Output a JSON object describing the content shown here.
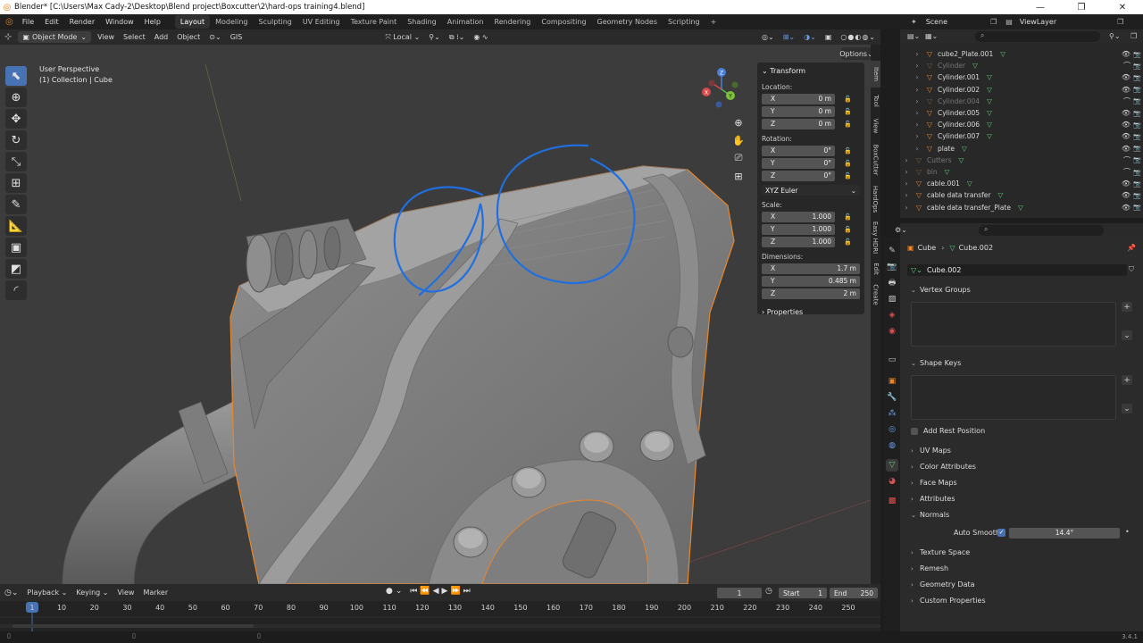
{
  "window": {
    "title": "Blender* [C:\\Users\\Max Cady-2\\Desktop\\Blend project\\Boxcutter\\2\\hard-ops training4.blend]",
    "controls": [
      "—",
      "❐",
      "✕"
    ]
  },
  "menu": [
    "File",
    "Edit",
    "Render",
    "Window",
    "Help"
  ],
  "workspaces": {
    "tabs": [
      "Layout",
      "Modeling",
      "Sculpting",
      "UV Editing",
      "Texture Paint",
      "Shading",
      "Animation",
      "Rendering",
      "Compositing",
      "Geometry Nodes",
      "Scripting"
    ],
    "active": "Layout",
    "add": "+"
  },
  "top_right": {
    "scene": "Scene",
    "view_layer": "ViewLayer"
  },
  "viewport_header": {
    "mode": "Object Mode",
    "menus": [
      "View",
      "Select",
      "Add",
      "Object"
    ],
    "gis": "GIS",
    "transform_orientation": "Local"
  },
  "viewport": {
    "view_name": "User Perspective",
    "collection_info": "(1) Collection | Cube",
    "options": "Options",
    "gizmo": {
      "x": "X",
      "y": "Y",
      "z": "Z"
    }
  },
  "n_panel": {
    "title": "Transform",
    "location": {
      "label": "Location:",
      "x": "0 m",
      "y": "0 m",
      "z": "0 m"
    },
    "rotation": {
      "label": "Rotation:",
      "x": "0°",
      "y": "0°",
      "z": "0°"
    },
    "rotation_mode": "XYZ Euler",
    "scale": {
      "label": "Scale:",
      "x": "1.000",
      "y": "1.000",
      "z": "1.000"
    },
    "dimensions": {
      "label": "Dimensions:",
      "x": "1.7 m",
      "y": "0.485 m",
      "z": "2 m"
    },
    "properties": "Properties",
    "axis": {
      "x": "X",
      "y": "Y",
      "z": "Z"
    }
  },
  "side_tabs": [
    "Item",
    "Tool",
    "View",
    "BoxCutter",
    "HardOps",
    "Easy HDRI",
    "Edit",
    "Create"
  ],
  "outliner": {
    "rows": [
      {
        "name": "cube2_Plate.001",
        "dim": false,
        "indent": 1
      },
      {
        "name": "Cylinder",
        "dim": true,
        "indent": 1
      },
      {
        "name": "Cylinder.001",
        "dim": false,
        "indent": 1
      },
      {
        "name": "Cylinder.002",
        "dim": false,
        "indent": 1
      },
      {
        "name": "Cylinder.004",
        "dim": true,
        "indent": 1
      },
      {
        "name": "Cylinder.005",
        "dim": false,
        "indent": 1
      },
      {
        "name": "Cylinder.006",
        "dim": false,
        "indent": 1
      },
      {
        "name": "Cylinder.007",
        "dim": false,
        "indent": 1
      },
      {
        "name": "plate",
        "dim": false,
        "indent": 1
      },
      {
        "name": "Cutters",
        "dim": true,
        "indent": 0
      },
      {
        "name": "bin",
        "dim": true,
        "indent": 0
      },
      {
        "name": "cable.001",
        "dim": false,
        "indent": 0
      },
      {
        "name": "cable data transfer",
        "dim": false,
        "indent": 0
      },
      {
        "name": "cable data transfer_Plate",
        "dim": false,
        "indent": 0
      }
    ]
  },
  "properties": {
    "object": "Cube",
    "mesh": "Cube.002",
    "data_block": "Cube.002",
    "sections": {
      "vertex_groups": "Vertex Groups",
      "shape_keys": "Shape Keys",
      "add_rest_position": "Add Rest Position",
      "uv_maps": "UV Maps",
      "color_attributes": "Color Attributes",
      "face_maps": "Face Maps",
      "attributes": "Attributes",
      "normals": "Normals",
      "auto_smooth": "Auto Smooth",
      "auto_smooth_angle": "14.4°",
      "texture_space": "Texture Space",
      "remesh": "Remesh",
      "geometry_data": "Geometry Data",
      "custom_properties": "Custom Properties"
    }
  },
  "timeline": {
    "menus": [
      "Playback",
      "Keying",
      "View",
      "Marker"
    ],
    "current_frame": "1",
    "start_label": "Start",
    "start": "1",
    "end_label": "End",
    "end": "250",
    "ticks": [
      "1",
      "10",
      "20",
      "30",
      "40",
      "50",
      "60",
      "70",
      "80",
      "90",
      "100",
      "110",
      "120",
      "130",
      "140",
      "150",
      "160",
      "170",
      "180",
      "190",
      "200",
      "210",
      "220",
      "230",
      "240",
      "250"
    ]
  },
  "status": {
    "version": "3.4.1"
  },
  "colors": {
    "accent": "#4772b3",
    "selection_outline": "#e8862a",
    "annotation": "#1f6fe0",
    "mesh_icon": "#e8862a",
    "data_icon": "#5cd17a"
  }
}
